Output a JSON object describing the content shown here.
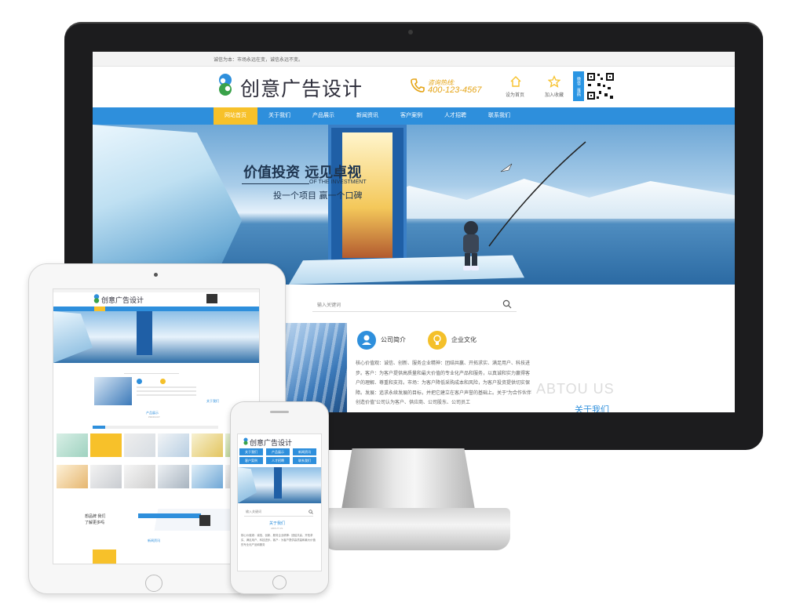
{
  "desktop": {
    "topbar_text": "诚信为本：市场永远在变，诚信永远不变。",
    "logo_text": "创意广告设计",
    "hotline_label": "咨询热线:",
    "hotline_number": "400-123-4567",
    "set_home_label": "设为首页",
    "add_favorite_label": "加入收藏",
    "qr_badge_label": "微信二维码",
    "nav": [
      "网站首页",
      "关于我们",
      "产品展示",
      "新闻资讯",
      "客户案例",
      "人才招聘",
      "联系我们"
    ],
    "banner": {
      "slogan_main": "价值投资 远见卓视",
      "slogan_en": "OF THE INVESTMENT",
      "slogan_sub": "投一个项目 赢一个口碑"
    },
    "search_placeholder": "输入关键词",
    "tabs": [
      {
        "label": "公司简介",
        "icon": "user-icon"
      },
      {
        "label": "企业文化",
        "icon": "bulb-icon"
      }
    ],
    "about_text": "核心价值观：诚信、创新、服务企业精神：团结共赢、开拓求实、满足用户、科技进步。客户：为客户提供高质量和最大价值的专业化产品和服务，以真诚和实力赢得客户的理解、尊重和支持。市场：为客户降低采购成本和风险，为客户投资提供切实保障。发展：追求永续发展的目标，并把它建立在客户声誉的基础上。关于“为合作伙伴创造价值”公司认为客户、供应商、公司股东、公司员工",
    "abtou_text": "ABTOU US",
    "about_title": "关于我们"
  },
  "tablet": {
    "logo_text": "创意广告设计",
    "about_title": "关于我们",
    "products_title": "产品展示",
    "products_en": "PRODUCT",
    "contact_lines": [
      "想品牌 我们",
      "了解更多吗"
    ],
    "news_title": "新闻资讯"
  },
  "phone": {
    "logo_text": "创意广告设计",
    "nav": [
      "关于我们",
      "产品展示",
      "新闻资讯",
      "客户案例",
      "人才招聘",
      "联系我们"
    ],
    "search_placeholder": "输入关键词",
    "about_title": "关于我们",
    "about_en": "ABOUT US",
    "about_text": "核心价值观：诚信、创新、服务企业精神：团结共赢、开拓求实、满足用户、科技进步。客户：为客户提供高质量和最大价值的专业化产品和服务"
  },
  "colors": {
    "brand_blue": "#2e8fdc",
    "accent_yellow": "#f7c12a",
    "hotline_orange": "#e5a416"
  }
}
